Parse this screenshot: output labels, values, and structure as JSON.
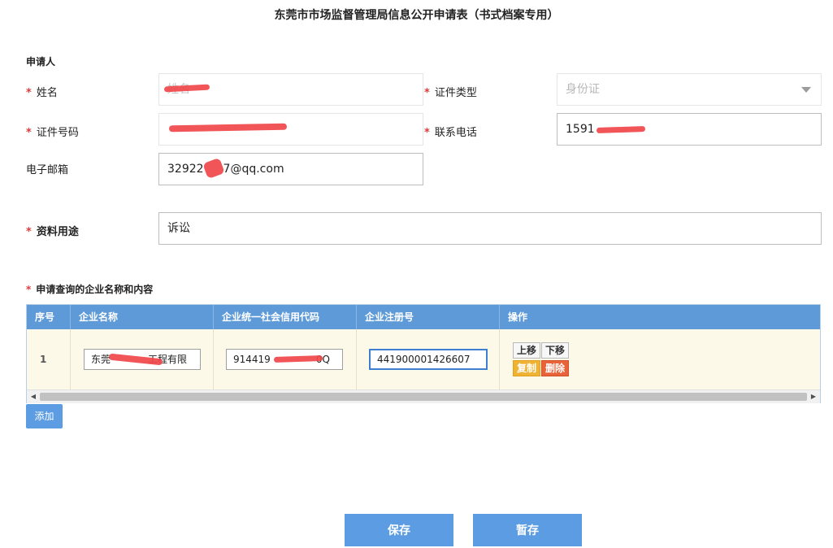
{
  "page": {
    "title": "东莞市市场监督管理局信息公开申请表（书式档案专用）"
  },
  "applicant": {
    "section_label": "申请人",
    "required_mark": "*",
    "name": {
      "label": "姓名",
      "placeholder": "姓名"
    },
    "id_type": {
      "label": "证件类型",
      "value": "身份证",
      "icon": "chevron-down-icon"
    },
    "id_number": {
      "label": "证件号码"
    },
    "phone": {
      "label": "联系电话",
      "value": "1591"
    },
    "email": {
      "label": "电子邮箱",
      "value_prefix": "32922",
      "value_suffix": "7@qq.com"
    }
  },
  "purpose": {
    "label": "资料用途",
    "value": "诉讼"
  },
  "enterprise": {
    "section_label": "申请查询的企业名称和内容",
    "columns": [
      "序号",
      "企业名称",
      "企业统一社会信用代码",
      "企业注册号",
      "操作"
    ],
    "rows": [
      {
        "index": "1",
        "name_prefix": "东莞",
        "name_suffix": "工程有限",
        "credit_code_prefix": "914419",
        "credit_code_suffix": "0Q",
        "reg_number": "441900001426607"
      }
    ],
    "actions": {
      "move_up": "上移",
      "move_down": "下移",
      "copy": "复制",
      "delete": "删除"
    },
    "add_label": "添加"
  },
  "footer": {
    "save_label": "保存",
    "draft_label": "暂存"
  },
  "colors": {
    "accent": "#5b9ce3",
    "header": "#5f9ad8",
    "required": "#e23a3a",
    "row_bg": "#fdf9e9",
    "copy": "#f0b233",
    "delete": "#e8633a",
    "redaction": "#f0464a"
  }
}
